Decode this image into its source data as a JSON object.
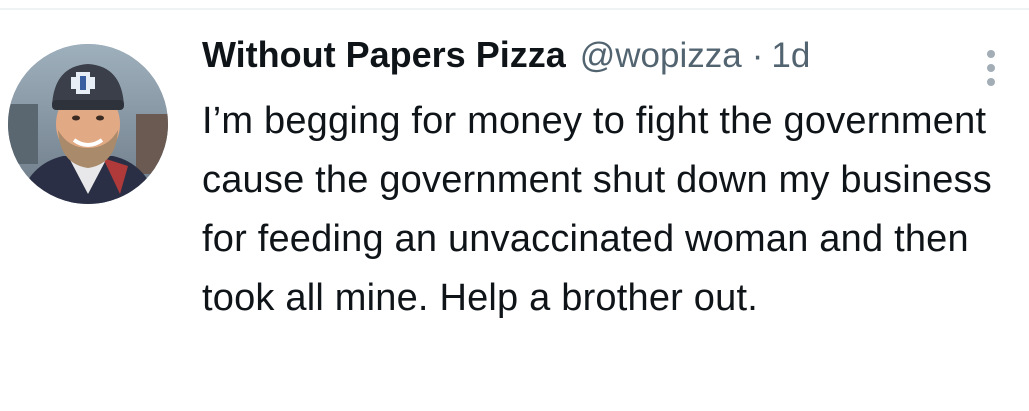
{
  "tweet": {
    "display_name": "Without Papers Pizza",
    "handle": "@wopizza",
    "separator": "·",
    "timestamp": "1d",
    "text": "I’m begging for money to fight the government cause the government shut down my business for feeding an unvaccinated woman and then took all mine. Help a brother out.",
    "more_icon": "more-vertical-icon"
  },
  "colors": {
    "primary_text": "#0f1419",
    "secondary_text": "#536471",
    "divider": "#eff3f4"
  }
}
